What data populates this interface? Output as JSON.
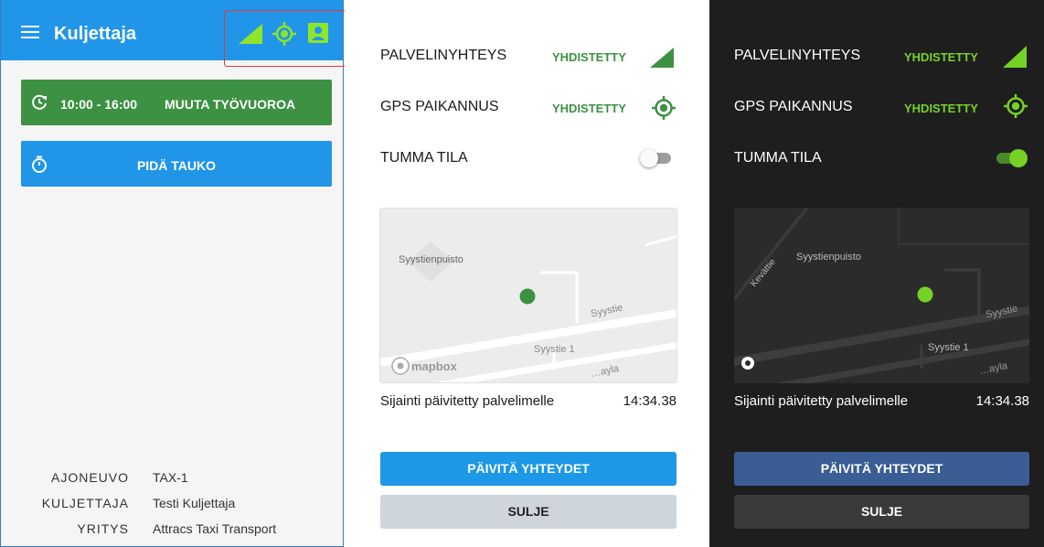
{
  "left": {
    "appbar": {
      "title": "Kuljettaja",
      "color": "#2196e8"
    },
    "status_icons": [
      "signal-icon",
      "gps-icon",
      "driver-badge-icon"
    ],
    "shift_button": {
      "time": "10:00 - 16:00",
      "label": "MUUTA TYÖVUOROA",
      "color": "#3d9142"
    },
    "break_button": {
      "label": "PIDÄ TAUKO",
      "color": "#2196e8"
    },
    "info": [
      {
        "key": "AJONEUVO",
        "value": "TAX-1"
      },
      {
        "key": "KULJETTAJA",
        "value": "Testi Kuljettaja"
      },
      {
        "key": "YRITYS",
        "value": "Attracs Taxi Transport"
      }
    ]
  },
  "light": {
    "service_label": "PALVELINYHTEYS",
    "service_status": "YHDISTETTY",
    "gps_label": "GPS PAIKANNUS",
    "gps_status": "YHDISTETTY",
    "dark_mode_label": "TUMMA TILA",
    "dark_mode_on": false,
    "map": {
      "park_label": "Syystienpuisto",
      "street_label": "Syystie",
      "address_label": "Syystie 1",
      "road_partial": "…ayla",
      "logo": "mapbox"
    },
    "location_text": "Sijainti päivitetty palvelimelle",
    "location_time": "14:34.38",
    "update_button": "PÄIVITÄ YHTEYDET",
    "close_button": "SULJE"
  },
  "dark": {
    "service_label": "PALVELINYHTEYS",
    "service_status": "YHDISTETTY",
    "gps_label": "GPS PAIKANNUS",
    "gps_status": "YHDISTETTY",
    "dark_mode_label": "TUMMA TILA",
    "dark_mode_on": true,
    "map": {
      "park_label": "Syystienpuisto",
      "street_label": "Syystie",
      "address_label": "Syystie 1",
      "side_street_label": "Kevättie",
      "road_partial": "…ayla"
    },
    "location_text": "Sijainti päivitetty palvelimelle",
    "location_time": "14:34.38",
    "update_button": "PÄIVITÄ YHTEYDET",
    "close_button": "SULJE"
  },
  "colors": {
    "accent_blue": "#2196e8",
    "green": "#3d9142",
    "bright_green": "#76d126",
    "dark_bg": "#1e1e1e",
    "dark_button": "#3a5d94"
  }
}
